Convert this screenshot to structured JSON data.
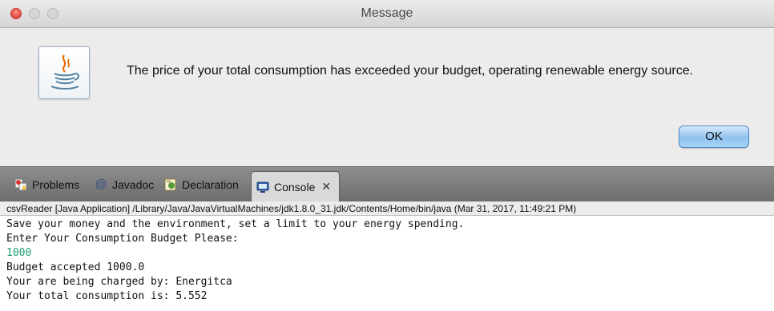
{
  "dialog": {
    "title": "Message",
    "message": "The price of your total consumption has exceeded your budget, operating renewable energy source.",
    "ok_label": "OK",
    "icon": "java-icon"
  },
  "tabs": [
    {
      "label": "Problems",
      "icon": "problems-icon"
    },
    {
      "label": "Javadoc",
      "icon": "at-icon"
    },
    {
      "label": "Declaration",
      "icon": "declaration-icon"
    },
    {
      "label": "Console",
      "icon": "console-icon",
      "active": true,
      "close": "✕"
    }
  ],
  "console": {
    "header": "csvReader [Java Application] /Library/Java/JavaVirtualMachines/jdk1.8.0_31.jdk/Contents/Home/bin/java (Mar 31, 2017, 11:49:21 PM)",
    "lines": [
      "Save your money and the environment, set a limit to your energy spending.",
      "Enter Your Consumption Budget Please:",
      "1000",
      "Budget accepted 1000.0",
      "Your are being charged by: Energitca",
      "Your total consumption is: 5.552"
    ],
    "input_color": "#1e9e6e"
  }
}
